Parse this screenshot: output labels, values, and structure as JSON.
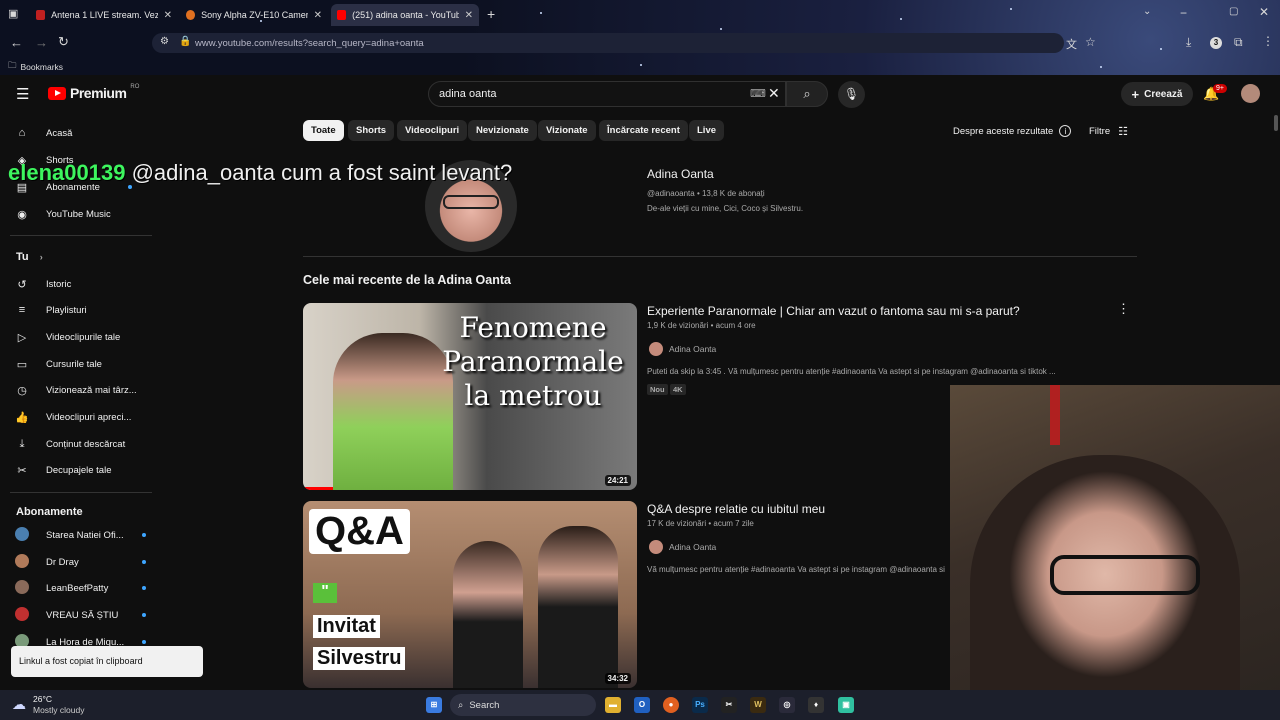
{
  "browser": {
    "tabs": [
      {
        "title": "Antena 1 LIVE stream. Vezi onli",
        "active": false
      },
      {
        "title": "Sony Alpha ZV-E10 Camera Mi",
        "active": false
      },
      {
        "title": "(251) adina oanta - YouTube",
        "active": true
      }
    ],
    "url": "www.youtube.com/results?search_query=adina+oanta",
    "bookmarks_label": "Bookmarks",
    "ext_badge": "3"
  },
  "youtube": {
    "logo_text": "Premium",
    "logo_region": "RO",
    "search_value": "adina oanta",
    "create_label": "Creează",
    "notif_count": "9+",
    "sidebar": {
      "main": [
        {
          "label": "Acasă",
          "icon": "home-icon"
        },
        {
          "label": "Shorts",
          "icon": "shorts-icon"
        },
        {
          "label": "Abonamente",
          "icon": "subscriptions-icon"
        },
        {
          "label": "YouTube Music",
          "icon": "music-icon"
        }
      ],
      "you_heading": "Tu",
      "you": [
        {
          "label": "Istoric",
          "icon": "history-icon"
        },
        {
          "label": "Playlisturi",
          "icon": "playlist-icon"
        },
        {
          "label": "Videoclipurile tale",
          "icon": "your-videos-icon"
        },
        {
          "label": "Cursurile tale",
          "icon": "courses-icon"
        },
        {
          "label": "Vizionează mai târz...",
          "icon": "watch-later-icon"
        },
        {
          "label": "Videoclipuri apreci...",
          "icon": "like-icon"
        },
        {
          "label": "Conținut descărcat",
          "icon": "download-icon"
        },
        {
          "label": "Decupajele tale",
          "icon": "clips-icon"
        }
      ],
      "subs_heading": "Abonamente",
      "subs": [
        {
          "label": "Starea Natiei Ofi...",
          "color": "#4a7fb0"
        },
        {
          "label": "Dr Dray",
          "color": "#b07a5a"
        },
        {
          "label": "LeanBeefPatty",
          "color": "#8a6a5a"
        },
        {
          "label": "VREAU SĂ ȘTIU",
          "color": "#c03030"
        },
        {
          "label": "La Hora de Miqu...",
          "color": "#7a9a7a"
        }
      ]
    },
    "chips": [
      "Toate",
      "Shorts",
      "Videoclipuri",
      "Nevizionate",
      "Vizionate",
      "Încărcate recent",
      "Live"
    ],
    "about_results": "Despre aceste rezultate",
    "filters": "Filtre",
    "channel": {
      "name": "Adina Oanta",
      "meta": "@adinaoanta • 13,8 K de abonați",
      "description": "De-ale vieții cu mine, Cici, Coco și Silvestru."
    },
    "section_title": "Cele mai recente de la Adina Oanta",
    "videos": [
      {
        "title": "Experiente Paranormale | Chiar am vazut o fantoma sau mi s-a parut?",
        "meta": "1,9 K de vizionări • acum 4 ore",
        "channel": "Adina Oanta",
        "description": "Puteti da skip la 3:45 . Vă mulțumesc pentru atenție #adinaoanta Va astept si pe instagram @adinaoanta si tiktok ...",
        "badges": [
          "Nou",
          "4K"
        ],
        "duration": "24:21",
        "thumb_lines": [
          "Fenomene",
          "Paranormale",
          "la metrou"
        ]
      },
      {
        "title": "Q&A despre relatie cu iubitul meu",
        "meta": "17 K de vizionări • acum 7 zile",
        "channel": "Adina Oanta",
        "description": "Vă mulțumesc pentru atenție #adinaoanta Va astept si pe instagram @adinaoanta si ti",
        "badges": [],
        "duration": "34:32",
        "thumb_lines": [
          "Q&A",
          "Invitat",
          "Silvestru"
        ]
      }
    ],
    "toast": "Linkul a fost copiat în clipboard"
  },
  "overlay": {
    "username": "elena00139",
    "message": "@adina_oanta cum a fost saint levant?"
  },
  "taskbar": {
    "weather_temp": "26°C",
    "weather_desc": "Mostly cloudy",
    "search_label": "Search"
  }
}
